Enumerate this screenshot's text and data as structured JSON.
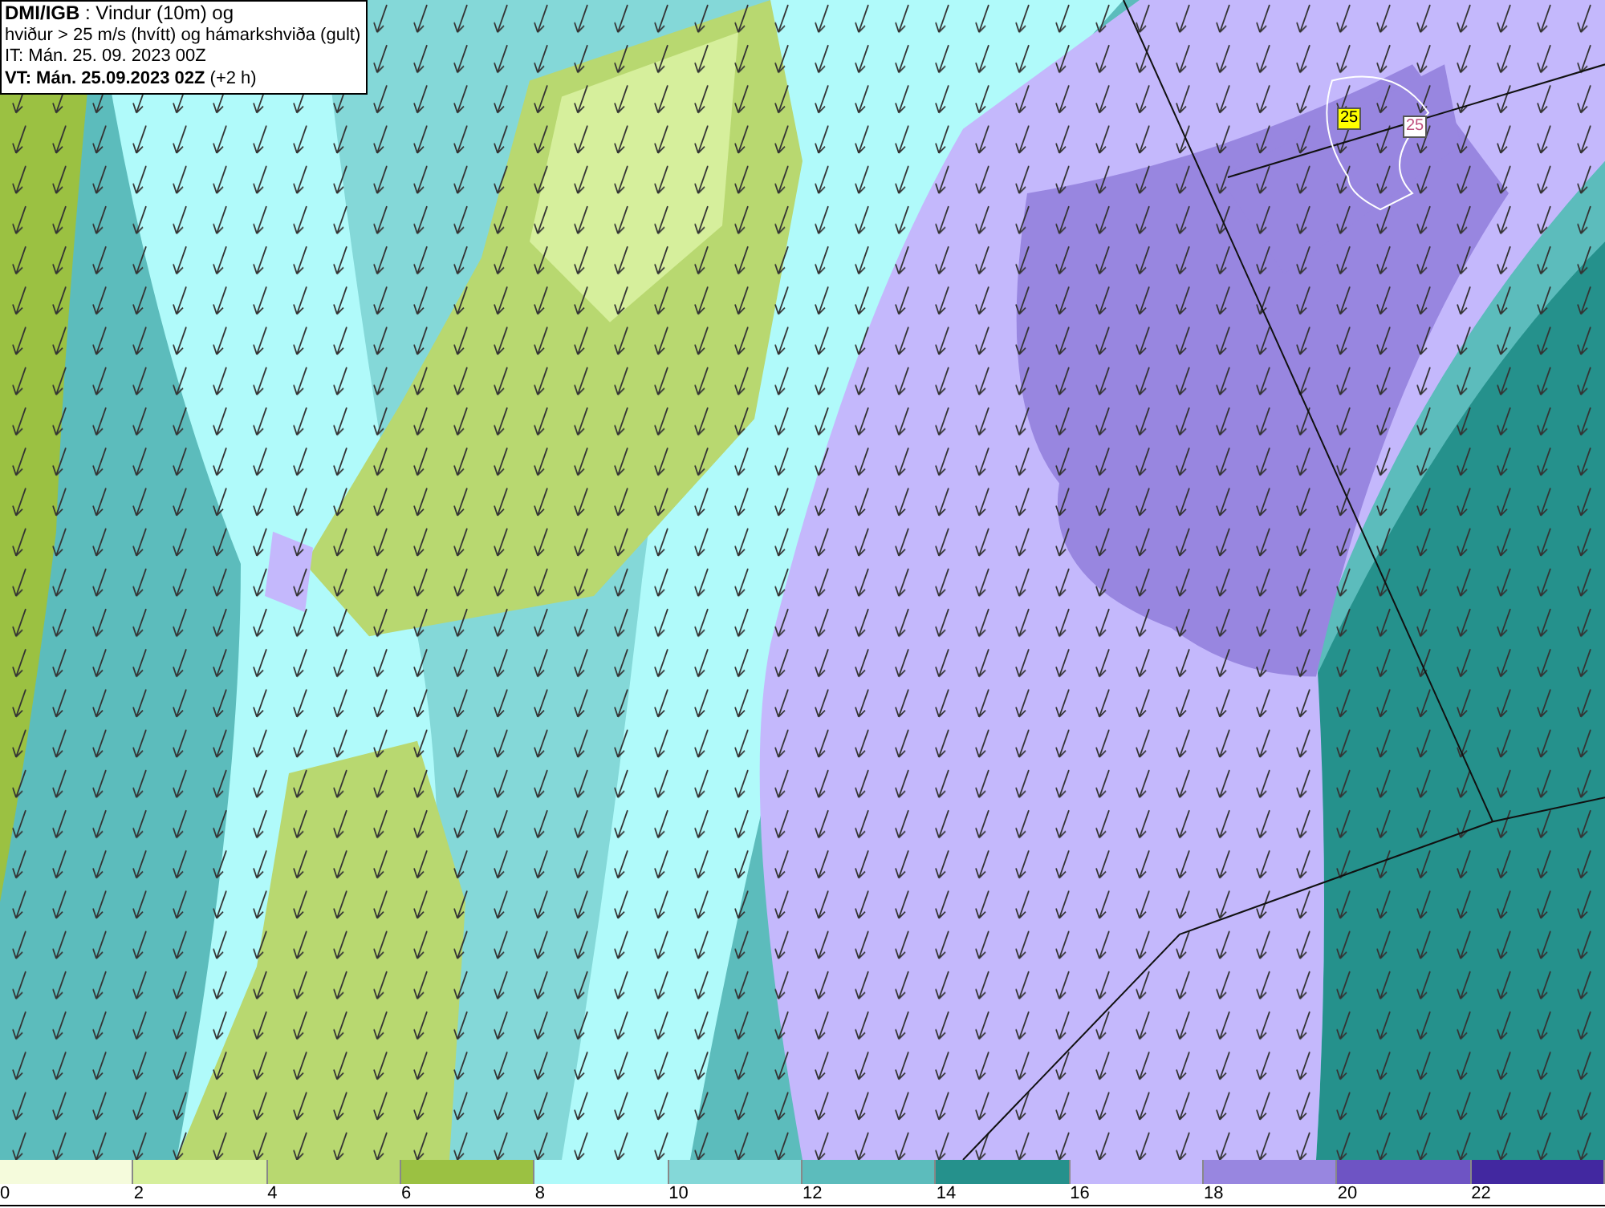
{
  "title_box": {
    "lines": [
      "**DMI/IGB** : Vindur (10m) og",
      "hviður > 25 m/s (hvítt) og hámarkshviða (gult)",
      "IT: Mán. 25. 09. 2023 00Z",
      "**VT: Mán. 25.09.2023 02Z** (+2 h)"
    ]
  },
  "map_labels": [
    {
      "text": "25",
      "color": "#ffff00"
    },
    {
      "text": "25",
      "color": "#ffffff"
    }
  ],
  "legend": [
    {
      "label": "0",
      "color": "#f5fbdc"
    },
    {
      "label": "2",
      "color": "#d6ef9c"
    },
    {
      "label": "4",
      "color": "#b8d870"
    },
    {
      "label": "6",
      "color": "#9bc142"
    },
    {
      "label": "8",
      "color": "#b0fafa"
    },
    {
      "label": "10",
      "color": "#84d8d8"
    },
    {
      "label": "12",
      "color": "#5cbcbc"
    },
    {
      "label": "14",
      "color": "#25918c"
    },
    {
      "label": "16",
      "color": "#c4b8fc"
    },
    {
      "label": "18",
      "color": "#9886e0"
    },
    {
      "label": "20",
      "color": "#6e54c4"
    },
    {
      "label": "22",
      "color": "#4228a0"
    }
  ]
}
